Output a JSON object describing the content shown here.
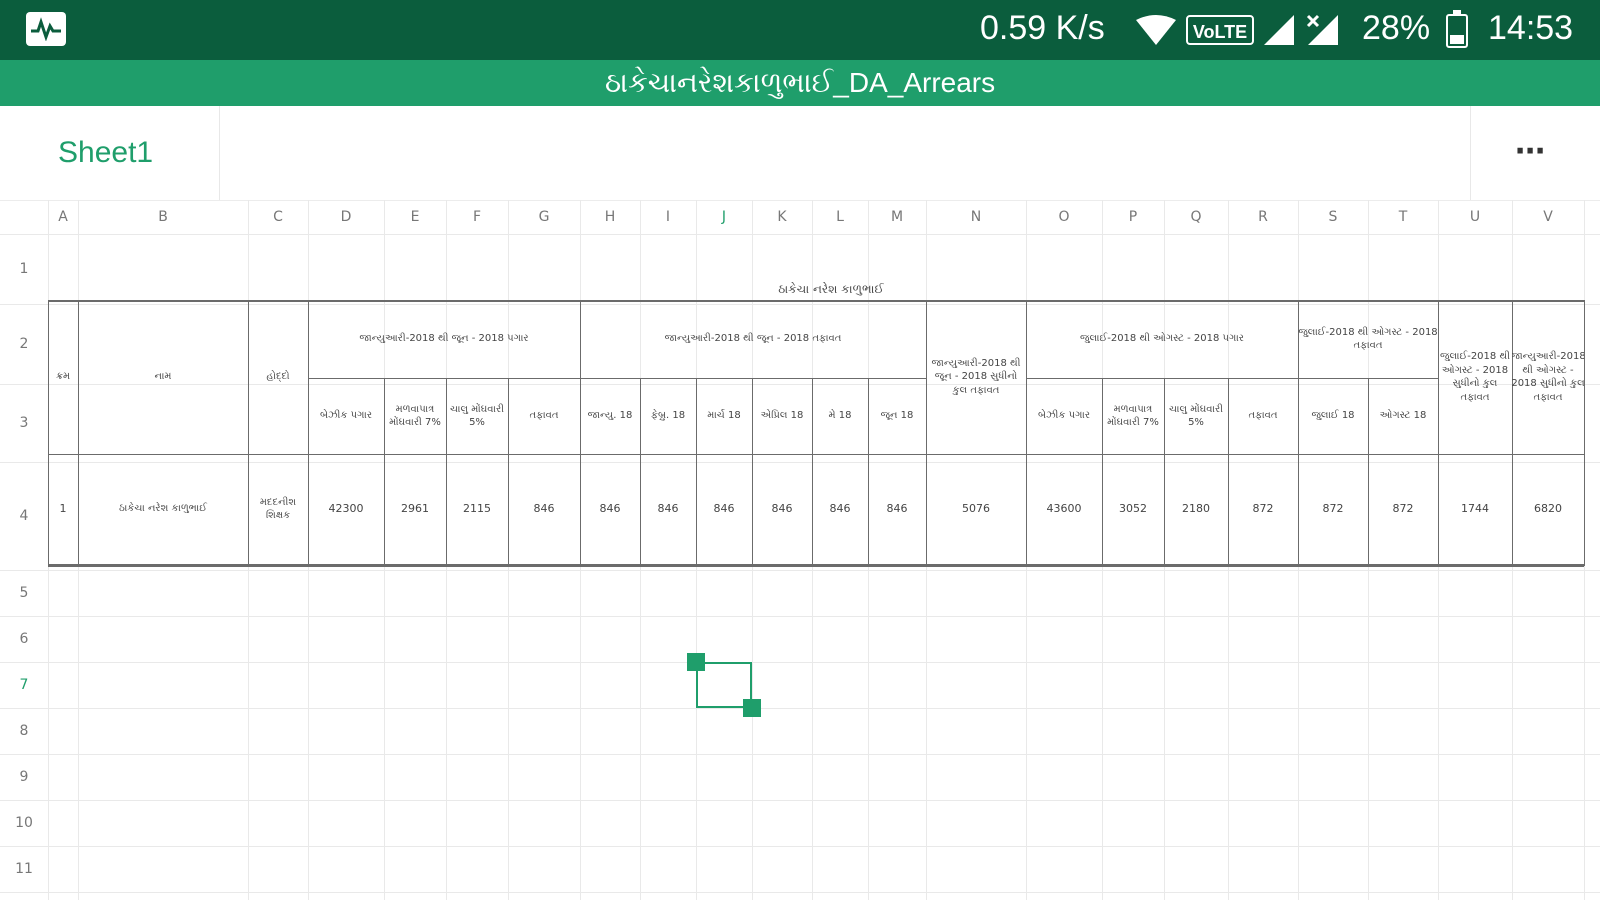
{
  "status_bar": {
    "speed": "0.59 K/s",
    "volte": "VoLTE",
    "battery": "28%",
    "time": "14:53"
  },
  "doc_title": "ઠાકેચાનરેશકાળુભાઈ_DA_Arrears",
  "tab": {
    "label": "Sheet1",
    "more": "⋯"
  },
  "columns": [
    "A",
    "B",
    "C",
    "D",
    "E",
    "F",
    "G",
    "H",
    "I",
    "J",
    "K",
    "L",
    "M",
    "N",
    "O",
    "P",
    "Q",
    "R",
    "S",
    "T",
    "U",
    "V"
  ],
  "rows": [
    "1",
    "2",
    "3",
    "4",
    "5",
    "6",
    "7",
    "8",
    "9",
    "10",
    "11"
  ],
  "sheet": {
    "title": "ઠાકેચા નરેશ કાળુભાઈ",
    "headers": {
      "sr": "ક્રમ",
      "name": "નામ",
      "post": "હોદ્દો",
      "group1": "જાન્યુઆરી-2018 થી જૂન - 2018 પગાર",
      "group2": "જાન્યુઆરી-2018 થી જૂન - 2018 તફાવત",
      "group3": "જાન્યુઆરી-2018 થી જૂન - 2018 સુધીનો કુલ તફાવત",
      "group4": "જુલાઈ-2018 થી ઓગસ્ટ - 2018 પગાર",
      "group5": "જુલાઈ-2018 થી ઓગસ્ટ - 2018 તફાવત",
      "group6": "જુલાઈ-2018 થી ઓગસ્ટ - 2018 સુધીનો કુલ તફાવત",
      "group7": "જાન્યુઆરી-2018 થી ઓગસ્ટ - 2018 સુધીનો કુલ તફાવત",
      "sub": [
        "બેઝીક પગાર",
        "મળવાપાત્ર મોંઘવારી 7%",
        "ચાલુ મોંઘવારી 5%",
        "તફાવત",
        "જાન્યુ. 18",
        "ફેબ્રુ. 18",
        "માર્ચ 18",
        "એપ્રિલ 18",
        "મે 18",
        "જૂન 18",
        "બેઝીક પગાર",
        "મળવાપાત્ર મોંઘવારી 7%",
        "ચાલુ મોંઘવારી 5%",
        "તફાવત",
        "જુલાઈ 18",
        "ઓગસ્ટ 18"
      ]
    },
    "row": {
      "sr": "1",
      "name": "ઠાકેચા નરેશ કાળુભાઈ",
      "post": "મદદનીશ શિક્ષક",
      "values": [
        "42300",
        "2961",
        "2115",
        "846",
        "846",
        "846",
        "846",
        "846",
        "846",
        "846",
        "5076",
        "43600",
        "3052",
        "2180",
        "872",
        "872",
        "872",
        "1744",
        "6820"
      ]
    }
  },
  "colors": {
    "status_bar": "#0b5d3d",
    "title_bar": "#1f9e6b",
    "accent": "#1f9e6b"
  }
}
